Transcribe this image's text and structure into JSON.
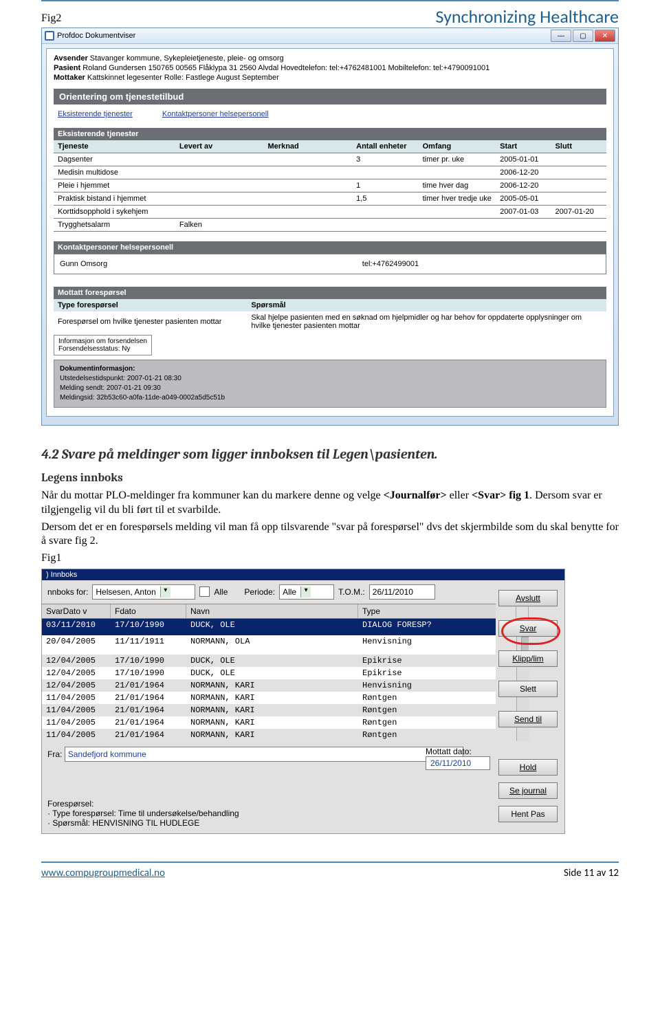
{
  "header": {
    "brand": "Synchronizing Healthcare"
  },
  "fig_top_label": "Fig2",
  "window": {
    "title": "Profdoc Dokumentviser",
    "meta": {
      "avsender_label": "Avsender",
      "avsender": "Stavanger kommune, Sykepleietjeneste, pleie- og omsorg",
      "pasient_label": "Pasient",
      "pasient": "Roland Gundersen   150765 00565  Flåklypa 31 2560  Alvdal Hovedtelefon: tel:+4762481001  Mobiltelefon:  tel:+4790091001",
      "mottaker_label": "Mottaker",
      "mottaker": "Kattskinnet legesenter Rolle:   Fastlege   August   September"
    },
    "section_title": "Orientering om tjenestetilbud",
    "links": {
      "eksisterende": "Eksisterende tjenester",
      "kontakt": "Kontaktpersoner helsepersonell"
    },
    "tjenester": {
      "heading": "Eksisterende tjenester",
      "cols": {
        "tjeneste": "Tjeneste",
        "levert": "Levert av",
        "merknad": "Merknad",
        "enheter": "Antall enheter",
        "omfang": "Omfang",
        "start": "Start",
        "slutt": "Slutt"
      },
      "rows": [
        {
          "tjeneste": "Dagsenter",
          "levert": "",
          "merknad": "",
          "enheter": "3",
          "omfang": "timer pr. uke",
          "start": "2005-01-01",
          "slutt": ""
        },
        {
          "tjeneste": "Medisin multidose",
          "levert": "",
          "merknad": "",
          "enheter": "",
          "omfang": "",
          "start": "2006-12-20",
          "slutt": ""
        },
        {
          "tjeneste": "Pleie i hjemmet",
          "levert": "",
          "merknad": "",
          "enheter": "1",
          "omfang": "time hver dag",
          "start": "2006-12-20",
          "slutt": ""
        },
        {
          "tjeneste": "Praktisk bistand i hjemmet",
          "levert": "",
          "merknad": "",
          "enheter": "1,5",
          "omfang": "timer hver tredje uke",
          "start": "2005-05-01",
          "slutt": ""
        },
        {
          "tjeneste": "Korttidsopphold i sykehjem",
          "levert": "",
          "merknad": "",
          "enheter": "",
          "omfang": "",
          "start": "2007-01-03",
          "slutt": "2007-01-20"
        },
        {
          "tjeneste": "Trygghetsalarm",
          "levert": "Falken",
          "merknad": "",
          "enheter": "",
          "omfang": "",
          "start": "",
          "slutt": ""
        }
      ]
    },
    "kontakt": {
      "heading": "Kontaktpersoner helsepersonell",
      "name": "Gunn  Omsorg",
      "tel": "tel:+4762499001"
    },
    "forespor": {
      "heading": "Mottatt forespørsel",
      "col_type": "Type forespørsel",
      "col_sporsmal": "Spørsmål",
      "type_val": "Forespørsel om hvilke tjenester pasienten mottar",
      "sporsmal_val": "Skal hjelpe pasienten med en søknad om hjelpmidler og har behov for oppdaterte opplysninger om hvilke tjenester pasienten mottar",
      "info_l1": "Informasjon om forsendelsen",
      "info_l2": "Forsendelsesstatus: Ny"
    },
    "docinfo": {
      "heading": "Dokumentinformasjon:",
      "l1": "Utstedelsestidspunkt: 2007-01-21 08:30",
      "l2": "Melding sendt: 2007-01-21 09:30",
      "l3": "Meldingsid: 32b53c60-a0fa-11de-a049-0002a5d5c51b"
    }
  },
  "chapter_title": "4.2 Svare på meldinger som ligger innboksen til Legen\\pasienten.",
  "sub_title": "Legens innboks",
  "para": {
    "p1a": "Når du mottar PLO-meldinger fra kommuner kan du markere denne og velge ",
    "p1b": "<Journalfør>",
    "p1c": " eller ",
    "p1d": "<Svar> fig 1",
    "p1e": ". Dersom svar er tilgjengelig vil du bli ført til et svarbilde.",
    "p2": "Dersom det er en forespørsels melding vil man få opp tilsvarende \"svar på forespørsel\" dvs det skjermbilde som du skal benytte for å svare fig 2."
  },
  "fig1_label": "Fig1",
  "innboks": {
    "title": "Innboks",
    "bar": {
      "for": "nnboks for:",
      "name": "Helsesen, Anton",
      "alle": "Alle",
      "periode": "Periode:",
      "periode_val": "Alle",
      "tom": "T.O.M.:",
      "tom_val": "26/11/2010"
    },
    "side_btns": {
      "avslutt": "Avslutt",
      "svar": "Svar",
      "klipp": "Klipp/lim",
      "slett": "Slett",
      "send": "Send til"
    },
    "cols": {
      "svdato": "SvarDato v",
      "fdato": "Fdato",
      "navn": "Navn",
      "type": "Type"
    },
    "rows": [
      {
        "sv": "03/11/2010",
        "fd": "17/10/1990",
        "navn": "DUCK, OLE",
        "type": "DIALOG FORESP?",
        "sel": true
      },
      {
        "sv": "20/04/2005",
        "fd": "11/11/1911",
        "navn": "NORMANN, OLA",
        "type": "Henvisning"
      },
      {
        "sv": "12/04/2005",
        "fd": "17/10/1990",
        "navn": "DUCK, OLE",
        "type": "Epikrise"
      },
      {
        "sv": "12/04/2005",
        "fd": "17/10/1990",
        "navn": "DUCK, OLE",
        "type": "Epikrise"
      },
      {
        "sv": "12/04/2005",
        "fd": "21/01/1964",
        "navn": "NORMANN, KARI",
        "type": "Henvisning"
      },
      {
        "sv": "11/04/2005",
        "fd": "21/01/1964",
        "navn": "NORMANN, KARI",
        "type": "Røntgen"
      },
      {
        "sv": "11/04/2005",
        "fd": "21/01/1964",
        "navn": "NORMANN, KARI",
        "type": "Røntgen"
      },
      {
        "sv": "11/04/2005",
        "fd": "21/01/1964",
        "navn": "NORMANN, KARI",
        "type": "Røntgen"
      },
      {
        "sv": "11/04/2005",
        "fd": "21/01/1964",
        "navn": "NORMANN, KARI",
        "type": "Røntgen"
      }
    ],
    "fra_label": "Fra:",
    "fra_val": "Sandefjord kommune",
    "mottatt_label": "Mottatt dato:",
    "mottatt_val": "26/11/2010",
    "side2": {
      "hold": "Hold",
      "se": "Se journal",
      "hent": "Hent Pas"
    },
    "foresp_label": "Forespørsel:",
    "foresp_l1": "· Type forespørsel: Time til undersøkelse/behandling",
    "foresp_l2": "· Spørsmål: HENVISNING TIL HUDLEGE"
  },
  "footer": {
    "url": "www.compugroupmedical.no",
    "page": "Side 11 av 12"
  }
}
